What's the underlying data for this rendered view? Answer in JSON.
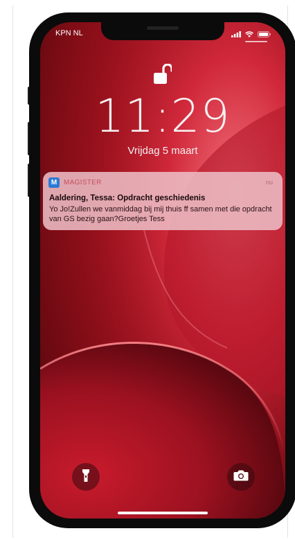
{
  "status_bar": {
    "carrier": "KPN NL"
  },
  "lock_screen": {
    "time": "11:29",
    "date": "Vrijdag 5 maart"
  },
  "notification": {
    "app_icon_letter": "M",
    "app_name": "MAGISTER",
    "timestamp": "nu",
    "title": "Aaldering, Tessa: Opdracht geschiedenis",
    "body": "Yo Jo!Zullen we vanmiddag bij mij thuis ff samen met die opdracht van GS bezig gaan?Groetjes Tess"
  },
  "quick_actions": {
    "left_icon": "flashlight-icon",
    "right_icon": "camera-icon"
  },
  "colors": {
    "wallpaper_red": "#a9131f",
    "notification_bg": "#ecbcc4",
    "app_icon": "#2c7ad6"
  }
}
